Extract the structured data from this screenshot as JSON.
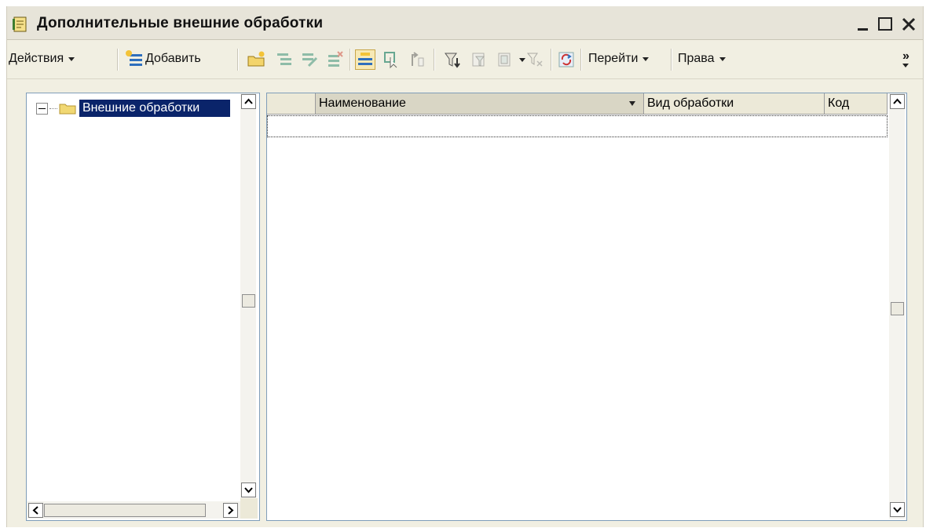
{
  "window": {
    "title": "Дополнительные внешние обработки",
    "icon": "processing-document-icon"
  },
  "toolbar": {
    "actions_label": "Действия",
    "add_label": "Добавить",
    "goto_label": "Перейти",
    "rights_label": "Права",
    "more_label": "»"
  },
  "tree": {
    "items": [
      {
        "label": "Внешние обработки",
        "icon": "folder-icon",
        "selected": true,
        "expanded": true
      }
    ]
  },
  "table": {
    "columns": [
      {
        "label": "Наименование"
      },
      {
        "label": "Вид обработки"
      },
      {
        "label": "Код"
      }
    ],
    "rows": []
  },
  "colors": {
    "selection": "#0a246a",
    "window_bg": "#f1efe2",
    "header_bg": "#ece9d8",
    "border": "#7f9db9"
  }
}
